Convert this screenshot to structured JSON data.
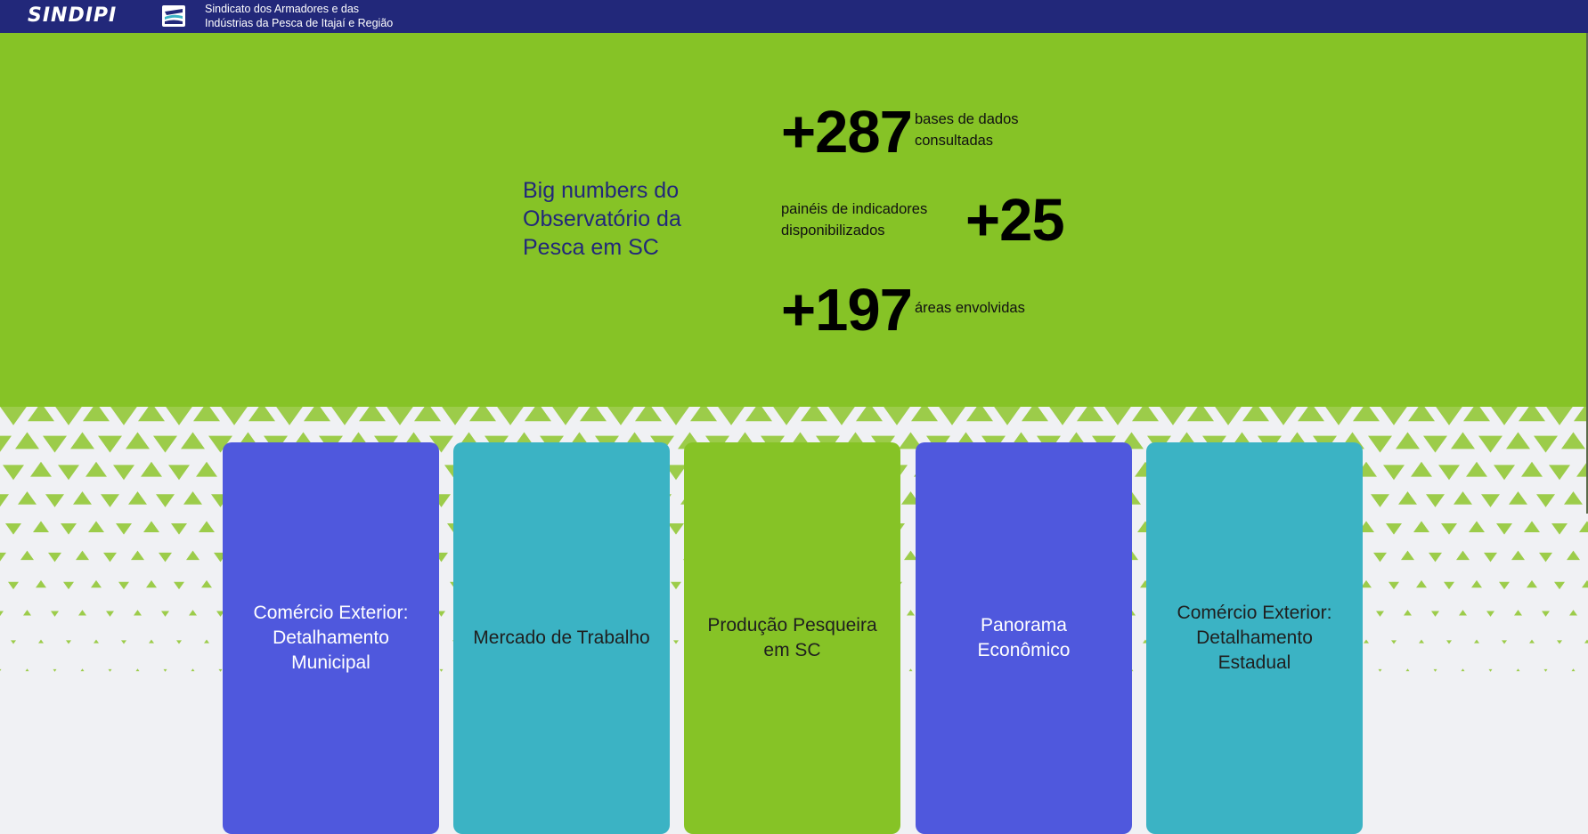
{
  "header": {
    "logo_text": "SINDIPI",
    "org_line1": "Sindicato dos Armadores e das",
    "org_line2": "Indústrias da Pesca de Itajaí e Região",
    "logo_icon": "fishing-vessel-emblem-icon"
  },
  "hero": {
    "title": "Big numbers do Observatório da Pesca em SC",
    "stats": [
      {
        "number": "+287",
        "line1": "bases de dados",
        "line2": "consultadas"
      },
      {
        "number": "+25",
        "line1": "painéis de indicadores",
        "line2": "disponibilizados"
      },
      {
        "number": "+197",
        "line1": "áreas envolvidas",
        "line2": ""
      }
    ]
  },
  "cards": [
    {
      "label": "Comércio Exterior: Detalhamento Municipal",
      "color": "#4f58dd",
      "text_color": "#ffffff"
    },
    {
      "label": "Mercado de Trabalho",
      "color": "#3bb3c4",
      "text_color": "#1f1f1f"
    },
    {
      "label": "Produção Pesqueira em SC",
      "color": "#86c326",
      "text_color": "#1f1f1f"
    },
    {
      "label": "Panorama Econômico",
      "color": "#4f58dd",
      "text_color": "#ffffff"
    },
    {
      "label": "Comércio Exterior: Detalhamento Estadual",
      "color": "#3bb3c4",
      "text_color": "#1f1f1f"
    }
  ],
  "colors": {
    "header_bg": "#22287a",
    "hero_bg": "#86c326",
    "accent_navy": "#22287a",
    "pattern_triangles": "#9ccc4a",
    "page_bg": "#f0f1f4"
  }
}
